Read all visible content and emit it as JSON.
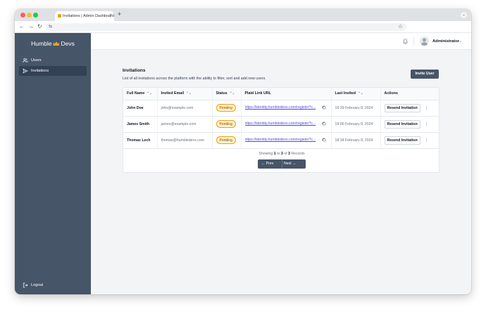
{
  "browser": {
    "tab_title": "Invitations | Admin Dashboard",
    "tab_close": "×",
    "new_tab": "+",
    "tab_menu": "⌄",
    "back": "←",
    "forward": "→",
    "reload": "↻",
    "site_info": "⇆",
    "bookmark": "☆"
  },
  "sidebar": {
    "brand_left": "Humble",
    "brand_right": "Devs",
    "items": [
      {
        "label": "Users",
        "icon": "users-icon",
        "active": false
      },
      {
        "label": "Invitations",
        "icon": "send-icon",
        "active": true
      }
    ],
    "logout_label": "Logout"
  },
  "header": {
    "username": "Administrator",
    "chevron": "⌄"
  },
  "page": {
    "title": "Invitations",
    "subtitle": "List of all invitations across the platform with the ability to filter, sort and add new users.",
    "invite_button": "Invite User"
  },
  "table": {
    "columns": [
      "Full Name",
      "Invited Email",
      "Status",
      "Plaid Link URL",
      "Last Invited",
      "Actions"
    ],
    "rows": [
      {
        "name": "John Doe",
        "email": "john@example.com",
        "status": "Pending",
        "url": "https://identity.humbledevs.com/register?c...",
        "last_invited": "19:29 February 8, 2024",
        "action": "Resend Invitation"
      },
      {
        "name": "James Smith",
        "email": "james@example.com",
        "status": "Pending",
        "url": "https://identity.humbledevs.com/register?c...",
        "last_invited": "19:00 February 8, 2024",
        "action": "Resend Invitation"
      },
      {
        "name": "Thomas Lech",
        "email": "thomas@humbledevs.com",
        "status": "Pending",
        "url": "https://identity.humbledevs.com/register?c...",
        "last_invited": "18:34 February 8, 2024",
        "action": "Resend Invitation"
      }
    ],
    "kebab": "⋮",
    "sort_glyph": "⌃⌄"
  },
  "pagination": {
    "showing": "Showing",
    "from": "1",
    "to_word": "to",
    "to": "3",
    "of_word": "of",
    "total": "3",
    "records_word": "Records",
    "prev": "Prev",
    "next": "Next"
  },
  "colors": {
    "sidebar": "#475569",
    "accent": "#475569",
    "pending_border": "#f59e0b",
    "pending_bg": "#fef3c7",
    "link": "#4f46e5",
    "brand_crown": "#e0a526"
  }
}
